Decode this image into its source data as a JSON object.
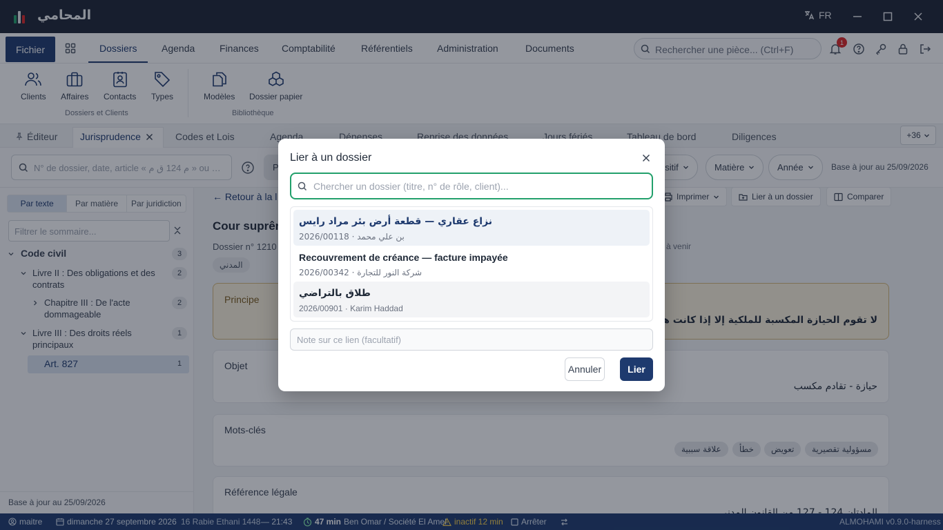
{
  "titlebar": {
    "app_name": "المحامي",
    "lang": "FR"
  },
  "menu": {
    "fichier": "Fichier",
    "tabs": [
      "Dossiers",
      "Agenda",
      "Finances",
      "Comptabilité",
      "Référentiels",
      "Administration",
      "Documents"
    ],
    "search_placeholder": "Rechercher une pièce... (Ctrl+F)",
    "notif_count": "1"
  },
  "ribbon": {
    "buttons": [
      "Clients",
      "Affaires",
      "Contacts",
      "Types",
      "Modèles",
      "Dossier papier"
    ],
    "groups": [
      "Dossiers et Clients",
      "Bibliothèque"
    ]
  },
  "doctabs": {
    "tabs": [
      "Éditeur",
      "Jurisprudence",
      "Codes et Lois",
      "Agenda",
      "Dépenses",
      "Reprise des données",
      "Jours fériés",
      "Tableau de bord",
      "Diligences"
    ],
    "more": "+36"
  },
  "filters": {
    "search_placeholder": "N° de dossier, date, article « م 124 ق م » ou …",
    "pill_p": "P",
    "pill_positif": "ositif",
    "pill_matiere": "Matière",
    "pill_annee": "Année",
    "updated": "Base à jour au 25/09/2026"
  },
  "sidebar": {
    "segments": [
      "Par texte",
      "Par matière",
      "Par juridiction"
    ],
    "filter_placeholder": "Filtrer le sommaire...",
    "tree": [
      {
        "label": "Code civil",
        "count": "3"
      },
      {
        "label": "Livre II : Des obligations et des contrats",
        "count": "2"
      },
      {
        "label": "Chapitre III : De l'acte dommageable",
        "count": "2"
      },
      {
        "label": "Livre III : Des droits réels principaux",
        "count": "1"
      },
      {
        "label": "Art. 827",
        "count": "1"
      }
    ],
    "footer": "Base à jour au 25/09/2026"
  },
  "content": {
    "back": "Retour à la l",
    "tools": [
      "Imprimer",
      "Lier à un dossier",
      "Comparer"
    ],
    "court": "Cour suprêm",
    "dossier_no": "Dossier n° 1210",
    "avenir": "e à venir",
    "chip": "المدني",
    "principe_label": "Principe",
    "principe_text": "لا تقوم الحيازة المكسبة للملكية إلا إذا كانت هادئة و",
    "objet_label": "Objet",
    "objet_text": "حيازة - تقادم مكسب",
    "motscles_label": "Mots-clés",
    "keywords": [
      "علاقة سببية",
      "خطأ",
      "تعويض",
      "مسؤولية تقصيرية"
    ],
    "ref_label": "Référence légale",
    "ref_text": "المادتان 124 - 127 من القانون المدني"
  },
  "status": {
    "user": "maitre",
    "date": "dimanche 27 septembre 2026",
    "hijri": "16 Rabie Ethani 1448",
    "time": "— 21:43",
    "timer": "47 min",
    "client": "Ben Omar / Société El Amel",
    "inactive": "inactif 12 min",
    "stop": "Arrêter",
    "version": "ALMOHAMI v0.9.0-harness"
  },
  "modal": {
    "title": "Lier à un dossier",
    "search_placeholder": "Chercher un dossier (titre, n° de rôle, client)...",
    "items": [
      {
        "title": "نزاع عقاري — قطعة أرض بئر مراد رايس",
        "sub": "2026/00118 · بن علي محمد"
      },
      {
        "title": "Recouvrement de créance — facture impayée",
        "sub": "2026/00342 · شركة النور للتجارة"
      },
      {
        "title": "طلاق بالتراضي",
        "sub": "2026/00901 · Karim Haddad"
      }
    ],
    "note_placeholder": "Note sur ce lien (facultatif)",
    "cancel": "Annuler",
    "ok": "Lier"
  },
  "colors": {
    "primary": "#1e3a6e",
    "titlebar": "#1c2434",
    "accent_green": "#22a06b",
    "principe_bg": "#fbf3dc"
  }
}
